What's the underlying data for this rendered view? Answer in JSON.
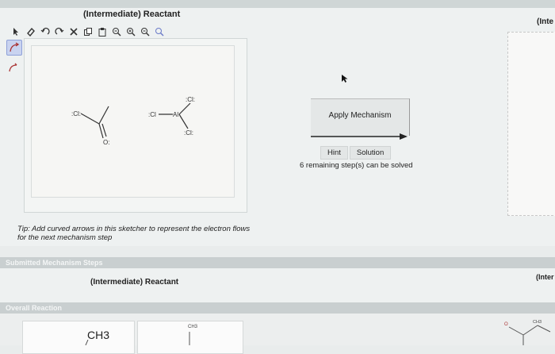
{
  "reactant_panel": {
    "title": "(Intermediate) Reactant",
    "tip": "Tip: Add curved arrows in this sketcher to represent the electron flows for the next mechanism step"
  },
  "right_panel": {
    "title": "(Inte"
  },
  "toolbar": {
    "icons": [
      "select-arrow-icon",
      "eraser-icon",
      "undo-icon",
      "redo-icon",
      "delete-icon",
      "copy-icon",
      "paste-icon",
      "zoom-fit-icon",
      "zoom-in-icon",
      "zoom-out-icon",
      "zoom-reset-icon"
    ]
  },
  "molecules": {
    "left": {
      "atom1": ":Cl:",
      "atom2": "O:"
    },
    "right": {
      "atom1": ":Cl",
      "atom2": "Al",
      "atom3": ":Cl:",
      "atom4": ":Cl:"
    }
  },
  "mechanism": {
    "apply_label": "Apply Mechanism",
    "hint_label": "Hint",
    "solution_label": "Solution",
    "remaining_text": "6 remaining step(s) can be solved"
  },
  "submitted_steps": {
    "band_label": "Submitted Mechanism Steps",
    "row_title": "(Intermediate) Reactant",
    "row_right_title": "(Inter"
  },
  "overall_reaction": {
    "band_label": "Overall Reaction",
    "ch3_large": "CH3",
    "ch3_small": "CH3",
    "ch3_right": "CH3"
  }
}
